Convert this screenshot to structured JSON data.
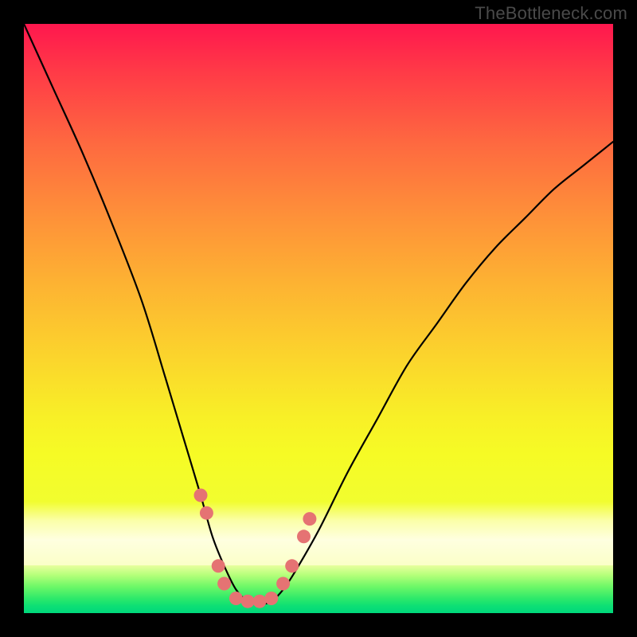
{
  "watermark": "TheBottleneck.com",
  "colors": {
    "frame": "#000000",
    "curve": "#000000",
    "marker": "#e57373",
    "gradient_top": "#ff174e",
    "gradient_mid": "#fbd52c",
    "gradient_pale": "#feffe0",
    "gradient_green": "#00d77c"
  },
  "chart_data": {
    "type": "line",
    "title": "",
    "xlabel": "",
    "ylabel": "",
    "xlim": [
      0,
      100
    ],
    "ylim": [
      0,
      100
    ],
    "series": [
      {
        "name": "bottleneck-curve",
        "x": [
          0,
          5,
          10,
          15,
          20,
          24,
          27,
          30,
          32,
          34,
          36,
          38,
          40,
          42,
          44,
          46,
          50,
          55,
          60,
          65,
          70,
          75,
          80,
          85,
          90,
          95,
          100
        ],
        "y": [
          100,
          89,
          78,
          66,
          53,
          40,
          30,
          20,
          13,
          8,
          4,
          2,
          1.5,
          2,
          4,
          7,
          14,
          24,
          33,
          42,
          49,
          56,
          62,
          67,
          72,
          76,
          80
        ]
      }
    ],
    "markers": [
      {
        "x": 30,
        "y": 20
      },
      {
        "x": 31,
        "y": 17
      },
      {
        "x": 33,
        "y": 8
      },
      {
        "x": 34,
        "y": 5
      },
      {
        "x": 36,
        "y": 2.5
      },
      {
        "x": 38,
        "y": 2
      },
      {
        "x": 40,
        "y": 2
      },
      {
        "x": 42,
        "y": 2.5
      },
      {
        "x": 44,
        "y": 5
      },
      {
        "x": 45.5,
        "y": 8
      },
      {
        "x": 47.5,
        "y": 13
      },
      {
        "x": 48.5,
        "y": 16
      }
    ],
    "background_gradient": {
      "orientation": "vertical",
      "stops": [
        {
          "pos": 0.0,
          "color": "#ff174e"
        },
        {
          "pos": 0.3,
          "color": "#fe8f39"
        },
        {
          "pos": 0.6,
          "color": "#fbd52c"
        },
        {
          "pos": 0.8,
          "color": "#f6fb25"
        },
        {
          "pos": 0.88,
          "color": "#feffe0"
        },
        {
          "pos": 0.93,
          "color": "#6cf867"
        },
        {
          "pos": 1.0,
          "color": "#00d77c"
        }
      ]
    }
  }
}
